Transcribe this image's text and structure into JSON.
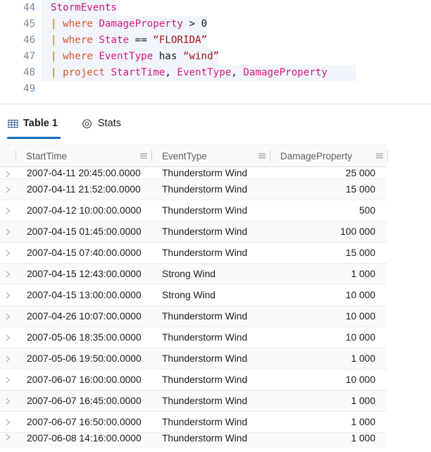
{
  "editor": {
    "lines": [
      {
        "number": "44",
        "highlight": true,
        "tokens": [
          {
            "t": "StormEvents",
            "c": "tok-table"
          }
        ]
      },
      {
        "number": "45",
        "highlight": true,
        "tokens": [
          {
            "t": "| ",
            "c": "tok-pipe"
          },
          {
            "t": "where ",
            "c": "tok-kw"
          },
          {
            "t": "DamageProperty",
            "c": "tok-col"
          },
          {
            "t": " > ",
            "c": "tok-op"
          },
          {
            "t": "0",
            "c": "tok-num"
          }
        ]
      },
      {
        "number": "46",
        "highlight": true,
        "tokens": [
          {
            "t": "| ",
            "c": "tok-pipe"
          },
          {
            "t": "where ",
            "c": "tok-kw"
          },
          {
            "t": "State",
            "c": "tok-col"
          },
          {
            "t": " == ",
            "c": "tok-op"
          },
          {
            "t": "“FLORIDA”",
            "c": "tok-str"
          }
        ]
      },
      {
        "number": "47",
        "highlight": true,
        "tokens": [
          {
            "t": "| ",
            "c": "tok-pipe"
          },
          {
            "t": "where ",
            "c": "tok-kw"
          },
          {
            "t": "EventType",
            "c": "tok-col"
          },
          {
            "t": " has ",
            "c": "tok-plain"
          },
          {
            "t": "“wind”",
            "c": "tok-str"
          }
        ]
      },
      {
        "number": "48",
        "highlight": true,
        "active": true,
        "tokens": [
          {
            "t": "| ",
            "c": "tok-pipe"
          },
          {
            "t": "project ",
            "c": "tok-kw"
          },
          {
            "t": "StartTime",
            "c": "tok-col"
          },
          {
            "t": ", ",
            "c": "tok-punc"
          },
          {
            "t": "EventType",
            "c": "tok-col"
          },
          {
            "t": ", ",
            "c": "tok-punc"
          },
          {
            "t": "DamageProperty",
            "c": "tok-col"
          }
        ]
      },
      {
        "number": "49",
        "highlight": false,
        "tokens": []
      }
    ]
  },
  "tabs": [
    {
      "id": "table-1",
      "label": "Table 1",
      "icon": "table-grid-icon",
      "active": true
    },
    {
      "id": "stats",
      "label": "Stats",
      "icon": "donut-chart-icon",
      "active": false
    }
  ],
  "grid": {
    "columns": [
      {
        "key": "StartTime",
        "label": "StartTime",
        "align": "left"
      },
      {
        "key": "EventType",
        "label": "EventType",
        "align": "left"
      },
      {
        "key": "DamageProperty",
        "label": "DamageProperty",
        "align": "right"
      }
    ],
    "rows": [
      {
        "StartTime": "2007-04-11 20:45:00.0000",
        "EventType": "Thunderstorm Wind",
        "DamageProperty": "25 000",
        "clip": "top"
      },
      {
        "StartTime": "2007-04-11 21:52:00.0000",
        "EventType": "Thunderstorm Wind",
        "DamageProperty": "15 000"
      },
      {
        "StartTime": "2007-04-12 10:00:00.0000",
        "EventType": "Thunderstorm Wind",
        "DamageProperty": "500"
      },
      {
        "StartTime": "2007-04-15 01:45:00.0000",
        "EventType": "Thunderstorm Wind",
        "DamageProperty": "100 000"
      },
      {
        "StartTime": "2007-04-15 07:40:00.0000",
        "EventType": "Thunderstorm Wind",
        "DamageProperty": "15 000"
      },
      {
        "StartTime": "2007-04-15 12:43:00.0000",
        "EventType": "Strong Wind",
        "DamageProperty": "1 000"
      },
      {
        "StartTime": "2007-04-15 13:00:00.0000",
        "EventType": "Strong Wind",
        "DamageProperty": "10 000"
      },
      {
        "StartTime": "2007-04-26 10:07:00.0000",
        "EventType": "Thunderstorm Wind",
        "DamageProperty": "10 000"
      },
      {
        "StartTime": "2007-05-06 18:35:00.0000",
        "EventType": "Thunderstorm Wind",
        "DamageProperty": "10 000"
      },
      {
        "StartTime": "2007-05-06 19:50:00.0000",
        "EventType": "Thunderstorm Wind",
        "DamageProperty": "1 000"
      },
      {
        "StartTime": "2007-06-07 16:00:00.0000",
        "EventType": "Thunderstorm Wind",
        "DamageProperty": "10 000"
      },
      {
        "StartTime": "2007-06-07 16:45:00.0000",
        "EventType": "Thunderstorm Wind",
        "DamageProperty": "1 000"
      },
      {
        "StartTime": "2007-06-07 16:50:00.0000",
        "EventType": "Thunderstorm Wind",
        "DamageProperty": "1 000"
      },
      {
        "StartTime": "2007-06-08 14:16:00.0000",
        "EventType": "Thunderstorm Wind",
        "DamageProperty": "1 000",
        "clip": "bottom"
      }
    ]
  },
  "colors": {
    "accent": "#0f6cbd",
    "row_alt": "#f9fafc",
    "header_bg": "#fafafa",
    "code_highlight": "#f2f5fb",
    "keyword": "#d6562b",
    "column_name": "#d6187f",
    "table_name": "#c7167f",
    "string": "#a31515",
    "pipe": "#c9922b",
    "line_number": "#6f8ba4"
  }
}
